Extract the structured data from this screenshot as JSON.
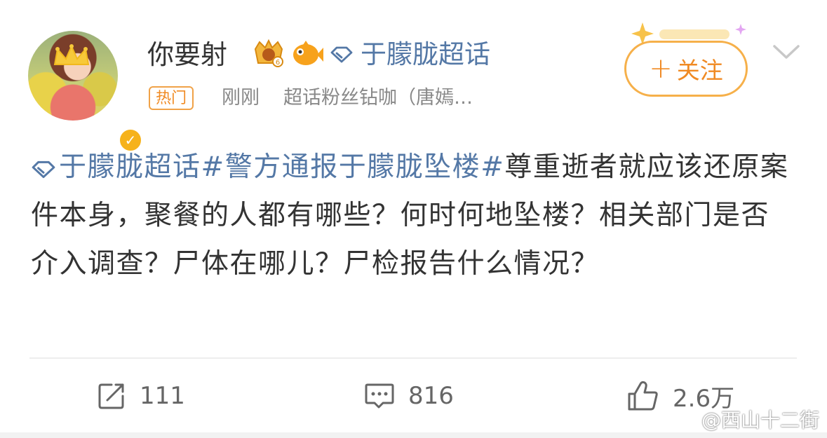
{
  "header": {
    "username": "你要射",
    "supertopic": "于朦胧超话",
    "hot_tag": "热门",
    "time": "刚刚",
    "source": "超话粉丝钻咖（唐嫣…",
    "follow_label": "关注"
  },
  "content": {
    "link_supertopic": "于朦胧超话",
    "link_hashtag": "#警方通报于朦胧坠楼#",
    "text": "尊重逝者就应该还原案件本身，聚餐的人都有哪些？何时何地坠楼？相关部门是否介入调查？尸体在哪儿？尸检报告什么情况？"
  },
  "actions": {
    "repost_count": "111",
    "comment_count": "816",
    "like_count": "2.6万"
  },
  "watermark": "@西山十二街",
  "colors": {
    "link": "#5478a6",
    "accent_orange": "#f08a23",
    "text": "#333333",
    "muted": "#888888"
  }
}
